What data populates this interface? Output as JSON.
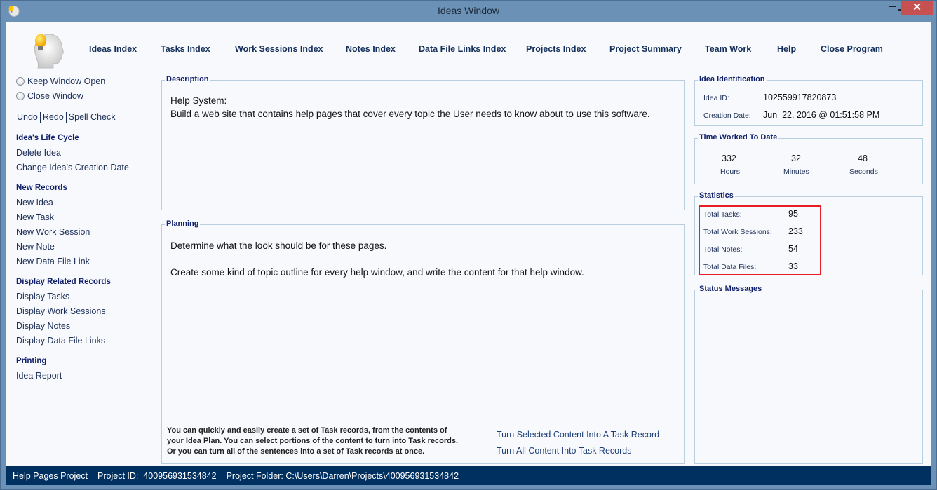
{
  "window": {
    "title": "Ideas Window",
    "controls": {
      "minimize": "minimize",
      "maximize": "maximize",
      "close": "✕"
    }
  },
  "topnav": [
    {
      "label": "Ideas Index",
      "mnemonic": "I"
    },
    {
      "label": "Tasks Index",
      "mnemonic": "T"
    },
    {
      "label": "Work Sessions Index",
      "mnemonic": "W"
    },
    {
      "label": "Notes Index",
      "mnemonic": "N"
    },
    {
      "label": "Data File Links Index",
      "mnemonic": "D"
    },
    {
      "label": "Projects Index",
      "mnemonic": ""
    },
    {
      "label": "Project Summary",
      "mnemonic": "P"
    },
    {
      "label": "Team Work",
      "mnemonic": "e"
    },
    {
      "label": "Help",
      "mnemonic": "H"
    },
    {
      "label": "Close Program",
      "mnemonic": "C"
    }
  ],
  "sidebar": {
    "radios": [
      {
        "label": "Keep Window Open",
        "checked": false
      },
      {
        "label": "Close Window",
        "checked": false
      }
    ],
    "edit_actions": [
      "Undo",
      "Redo",
      "Spell Check"
    ],
    "sections": [
      {
        "heading": "Idea's Life Cycle",
        "items": [
          "Delete Idea",
          "Change Idea's Creation Date"
        ]
      },
      {
        "heading": "New Records",
        "items": [
          "New Idea",
          "New Task",
          "New Work Session",
          "New Note",
          "New Data File Link"
        ]
      },
      {
        "heading": "Display Related Records",
        "items": [
          "Display Tasks",
          "Display Work Sessions",
          "Display Notes",
          "Display Data File Links"
        ]
      },
      {
        "heading": "Printing",
        "items": [
          "Idea Report"
        ]
      }
    ]
  },
  "description": {
    "legend": "Description",
    "lines": [
      "Help System:",
      "Build a web site that contains help pages that cover every topic the User needs to know about to use this software."
    ]
  },
  "planning": {
    "legend": "Planning",
    "lines": [
      "Determine what the look should be for these pages.",
      "Create some kind of topic outline for every help window, and write the content for that help window."
    ],
    "hint_lines": [
      "You can quickly and easily create a set of Task records, from the contents of",
      "your Idea Plan. You can select portions of the content to turn into Task records.",
      "Or you can turn all of the sentences into a set of Task records at once."
    ],
    "actions": [
      "Turn Selected Content Into A Task Record",
      "Turn All Content Into Task Records"
    ]
  },
  "identification": {
    "legend": "Idea Identification",
    "idea_id_label": "Idea ID:",
    "idea_id": "102559917820873",
    "creation_label": "Creation Date:",
    "creation_date": "Jun  22, 2016 @ 01:51:58 PM"
  },
  "time_worked": {
    "legend": "Time Worked To Date",
    "hours": "332",
    "hours_label": "Hours",
    "minutes": "32",
    "minutes_label": "Minutes",
    "seconds": "48",
    "seconds_label": "Seconds"
  },
  "statistics": {
    "legend": "Statistics",
    "rows": [
      {
        "label": "Total Tasks:",
        "value": "95"
      },
      {
        "label": "Total Work Sessions:",
        "value": "233"
      },
      {
        "label": "Total Notes:",
        "value": "54"
      },
      {
        "label": "Total Data Files:",
        "value": "33"
      }
    ]
  },
  "status_messages": {
    "legend": "Status Messages",
    "text": ""
  },
  "statusbar": {
    "project": "Help Pages Project",
    "project_id": "Project ID:  400956931534842",
    "project_folder": "Project Folder: C:\\Users\\Darren\\Projects\\400956931534842"
  },
  "colors": {
    "frame": "#6b91b6",
    "statusbar": "#00305f",
    "close_button": "#c75050",
    "highlight": "#e51e25",
    "heading": "#10206a"
  }
}
